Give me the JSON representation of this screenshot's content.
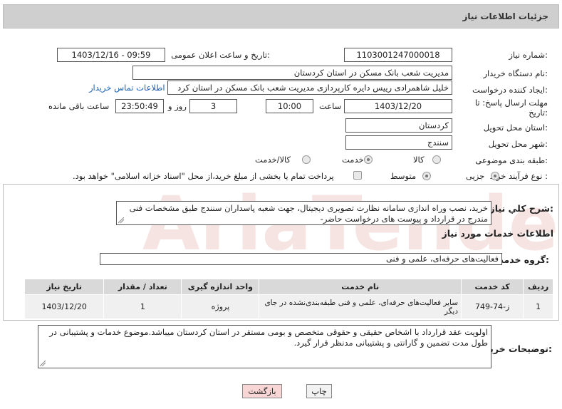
{
  "header": {
    "title": "جزئیات اطلاعات نیاز"
  },
  "fields": {
    "need_number_label": "شماره نیاز:",
    "need_number": "1103001247000018",
    "announce_label": "تاریخ و ساعت اعلان عمومی:",
    "announce_value": "1403/12/16 - 09:59",
    "buyer_org_label": "نام دستگاه خریدار:",
    "buyer_org": "مدیریت شعب بانک مسکن در استان کردستان",
    "creator_label": "ایجاد کننده درخواست:",
    "creator": "خلیل شاهمرادی رییس دایره کارپردازی مدیریت شعب بانک مسکن در استان کرد",
    "contact_link": "اطلاعات تماس خریدار",
    "deadline_label_1": "مهلت ارسال پاسخ: تا",
    "deadline_label_2": "تاریخ:",
    "deadline_date": "1403/12/20",
    "time_label": "ساعت",
    "deadline_time": "10:00",
    "days_value": "3",
    "days_label": "روز و",
    "remaining_value": "23:50:49",
    "remaining_label": "ساعت باقی مانده",
    "province_label": "استان محل تحویل:",
    "province": "کردستان",
    "city_label": "شهر محل تحویل:",
    "city": "سنندج",
    "category_label": "طبقه بندی موضوعی:",
    "category_options": [
      "کالا",
      "خدمت",
      "کالا/خدمت"
    ],
    "category_selected": "خدمت",
    "process_label": "نوع فرآیند خرید :",
    "process_options": [
      "جزیی",
      "متوسط"
    ],
    "process_selected": "جزیی",
    "payment_note": "پرداخت تمام یا بخشی از مبلغ خرید،از محل \"اسناد خزانه اسلامی\" خواهد بود."
  },
  "summary": {
    "label": "شرح کلي نياز:",
    "text": "خرید، نصب وراه اندازی سامانه نظارت تصویری دیجیتال، جهت شعبه پاسداران سنندج طبق مشخصات فنی مندرج در قرارداد و پیوست های درخواست حاضر-"
  },
  "services": {
    "section_title": "اطلاعات خدمات مورد نياز",
    "group_label": "گروه خدمت:",
    "group_value": "فعالیت‌های حرفه‌ای، علمی و فنی",
    "columns": [
      "ردیف",
      "کد خدمت",
      "نام خدمت",
      "واحد اندازه گیری",
      "تعداد / مقدار",
      "تاریخ نیاز"
    ],
    "rows": [
      [
        "1",
        "ز-74-749",
        "سایر فعالیت‌های حرفه‌ای، علمی و فنی طبقه‌بندی‌نشده در جای دیگر",
        "پروژه",
        "1",
        "1403/12/20"
      ]
    ]
  },
  "buyer_notes": {
    "label": "توضیحات خریدار:",
    "text": "اولویت عقد قرارداد با اشخاص حقیقی و حقوقی متخصص و بومی مستقر در استان کردستان میباشد.موضوع خدمات و پشتیبانی در طول مدت تضمین و گارانتی و پشتیبانی مدنظر قرار گیرد."
  },
  "buttons": {
    "print": "چاپ",
    "back": "بازگشت"
  },
  "watermark": {
    "text": "AriaTender.neT"
  },
  "colors": {
    "header_bg": "#cfcfcf",
    "link": "#1a5fb4",
    "back_btn_bg": "#f9d6d6"
  }
}
